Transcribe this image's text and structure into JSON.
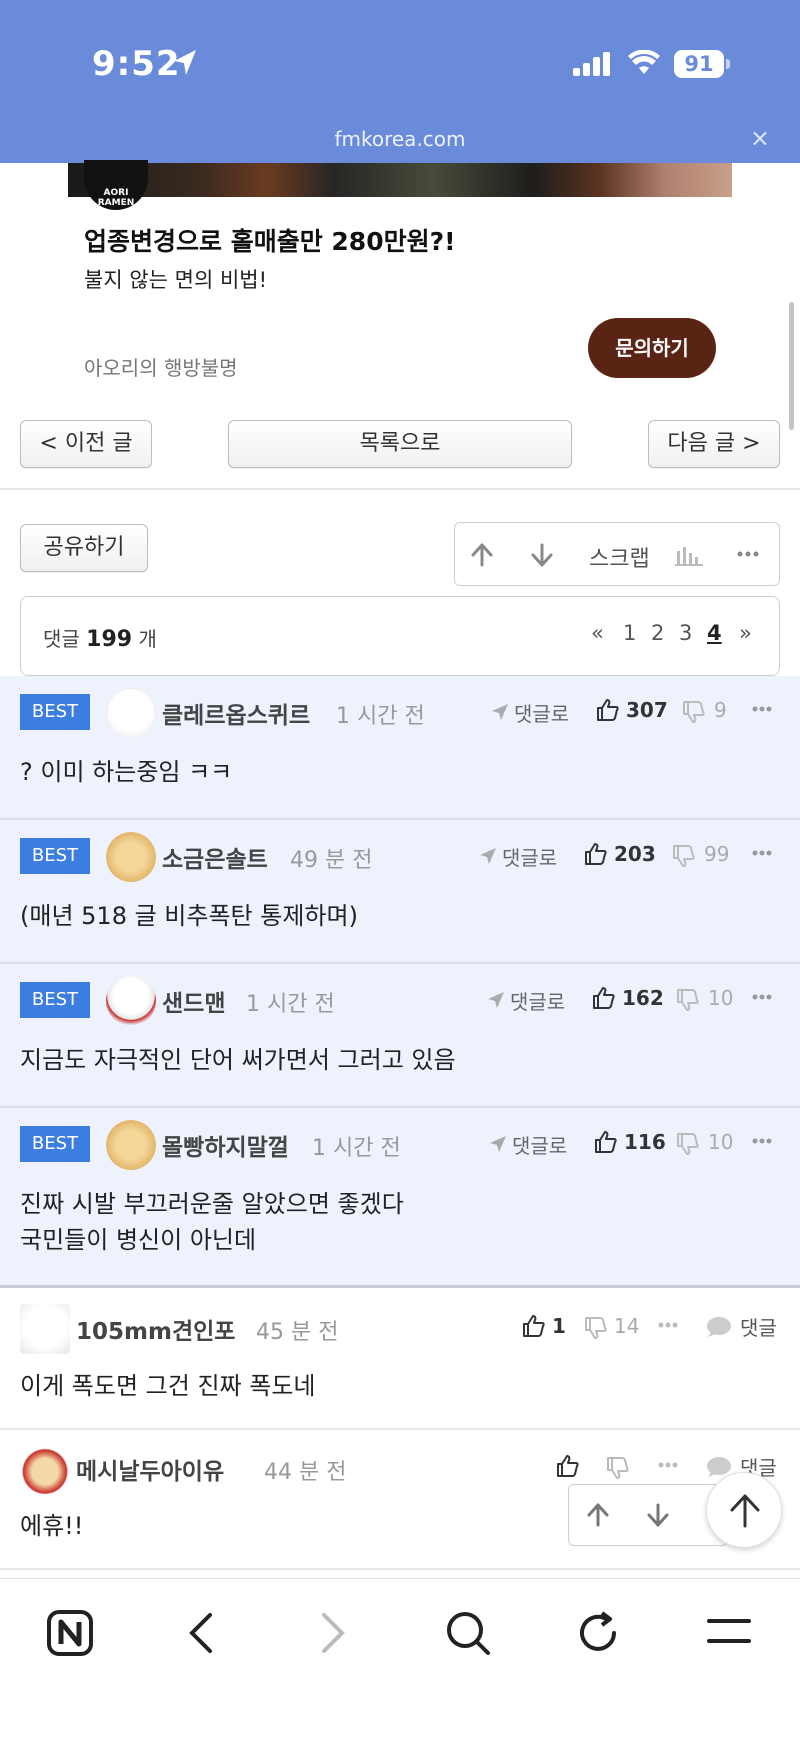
{
  "status": {
    "time": "9:52",
    "battery": "91",
    "url": "fmkorea.com",
    "close": "×"
  },
  "ad": {
    "logo_text": "AORI RAMEN",
    "title": "업종변경으로 홀매출만 280만원?!",
    "subtitle": "불지 않는 면의 비법!",
    "brand": "아오리의 행방불명",
    "cta": "문의하기"
  },
  "nav": {
    "prev": "< 이전 글",
    "list": "목록으로",
    "next": "다음 글 >"
  },
  "share": "공유하기",
  "scrap": "스크랩",
  "comments_bar": {
    "prefix": "댓글",
    "count": "199",
    "suffix": "개",
    "pages": [
      "«",
      "1",
      "2",
      "3",
      "4",
      "»"
    ],
    "current_page": "4"
  },
  "best_label": "BEST",
  "reply_label": "댓글로",
  "best_comments": [
    {
      "nick": "클레르옵스퀴르",
      "time": "1 시간 전",
      "up": "307",
      "down": "9",
      "text": "? 이미 하는중임 ㅋㅋ"
    },
    {
      "nick": "소금은솔트",
      "time": "49 분 전",
      "up": "203",
      "down": "99",
      "text": "(매년 518 글 비추폭탄 통제하며)"
    },
    {
      "nick": "샌드맨",
      "time": "1 시간 전",
      "up": "162",
      "down": "10",
      "text": "지금도 자극적인 단어 써가면서 그러고 있음"
    },
    {
      "nick": "몰빵하지말껄",
      "time": "1 시간 전",
      "up": "116",
      "down": "10",
      "text_1": "진짜 시발 부끄러운줄 알았으면 좋겠다",
      "text_2": "국민들이 병신이 아닌데"
    }
  ],
  "comments": [
    {
      "nick": "105mm견인포",
      "time": "45 분 전",
      "up": "1",
      "down": "14",
      "reply": "댓글",
      "text": "이게 폭도면 그건 진짜 폭도네"
    },
    {
      "nick": "메시날두아이유",
      "time": "44 분 전",
      "reply": "댓글",
      "text": "에휴!!"
    }
  ],
  "colors": {
    "status_bg": "#6a8bd9",
    "best_bg": "#eef2fd",
    "badge": "#3d7de0",
    "cta": "#5a2414"
  }
}
